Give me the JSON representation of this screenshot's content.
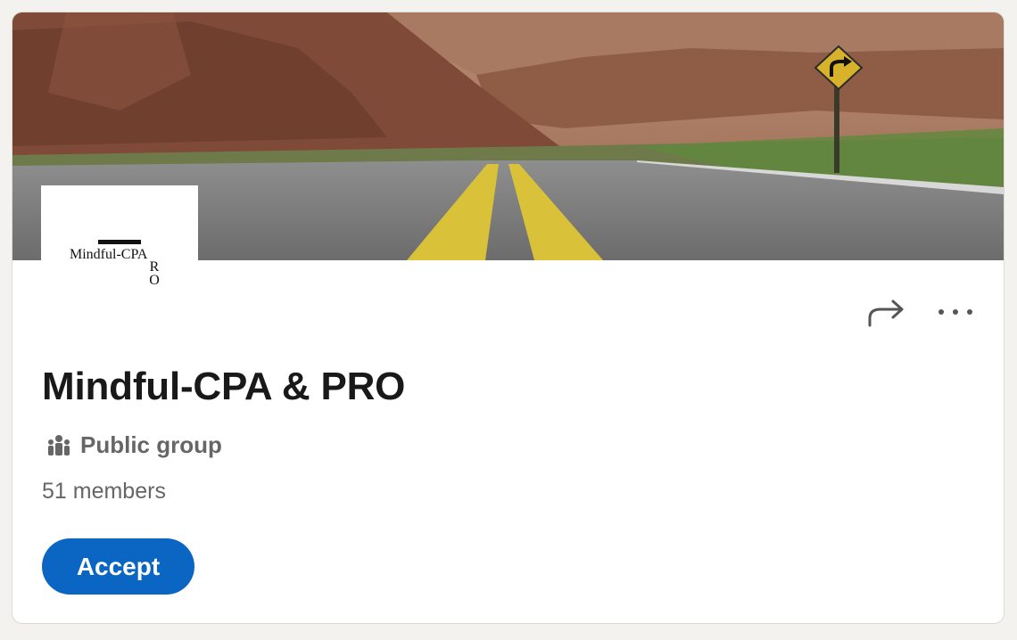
{
  "group": {
    "logo_text": "Mindful-CPA",
    "logo_subtext": "RO",
    "name": "Mindful-CPA & PRO",
    "visibility": "Public group",
    "members": "51 members"
  },
  "actions": {
    "share_icon": "share-arrow-icon",
    "more_icon": "more-options-icon"
  },
  "accept_label": "Accept",
  "colors": {
    "accent": "#0a66c2",
    "background": "#f4f2ee",
    "title": "#191919",
    "muted": "#666666"
  }
}
